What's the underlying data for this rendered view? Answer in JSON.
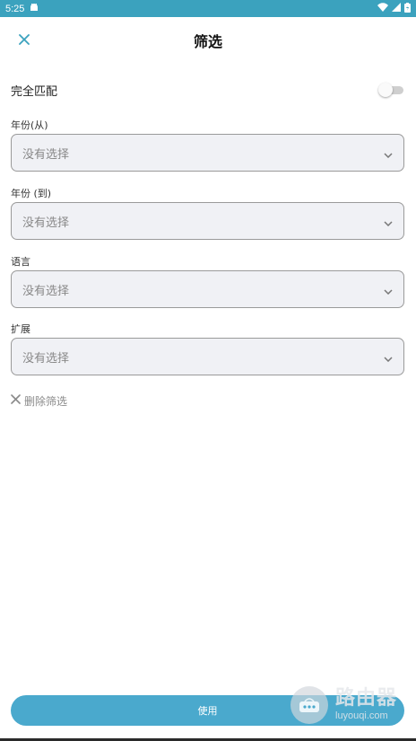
{
  "status_bar": {
    "time": "5:25",
    "icons": [
      "android-icon",
      "wifi-icon",
      "signal-icon",
      "battery-icon"
    ]
  },
  "header": {
    "title": "筛选",
    "close_icon": "close-icon"
  },
  "exact_match": {
    "label": "完全匹配",
    "enabled": false
  },
  "filters": [
    {
      "label": "年份(从)",
      "value": "没有选择"
    },
    {
      "label": "年份 (到)",
      "value": "没有选择"
    },
    {
      "label": "语言",
      "value": "没有选择"
    },
    {
      "label": "扩展",
      "value": "没有选择"
    }
  ],
  "remove_filter": {
    "label": "删除筛选"
  },
  "apply_button": {
    "label": "使用"
  },
  "watermark": {
    "title": "路由器",
    "domain": "luyouqi.com"
  },
  "colors": {
    "accent": "#3ba2be",
    "button": "#4aa9cd",
    "field_bg": "#f0f1f5"
  }
}
